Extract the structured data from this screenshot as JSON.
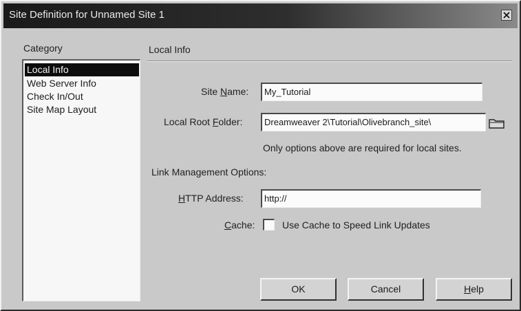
{
  "window": {
    "title": "Site Definition for Unnamed Site 1"
  },
  "category": {
    "label": "Category",
    "items": [
      "Local Info",
      "Web Server Info",
      "Check In/Out",
      "Site Map Layout"
    ]
  },
  "local_info": {
    "section_title": "Local Info",
    "site_name_label_pre": "Site ",
    "site_name_label_ul": "N",
    "site_name_label_post": "ame:",
    "site_name_value": "My_Tutorial",
    "root_folder_label_pre": "Local Root ",
    "root_folder_label_ul": "F",
    "root_folder_label_post": "older:",
    "root_folder_value": "Dreamweaver 2\\Tutorial\\Olivebranch_site\\",
    "required_note": "Only options above are required for local sites."
  },
  "link_management": {
    "label": "Link Management Options:",
    "http_label_ul": "H",
    "http_label_post": "TTP Address:",
    "http_value": "http://",
    "cache_label_ul": "C",
    "cache_label_post": "ache:",
    "cache_checkbox_label": "Use Cache to Speed Link Updates",
    "cache_checked": false
  },
  "buttons": {
    "ok": "OK",
    "cancel": "Cancel",
    "help_ul": "H",
    "help_post": "elp"
  },
  "icons": {
    "close": "close-icon",
    "folder": "folder-icon"
  }
}
